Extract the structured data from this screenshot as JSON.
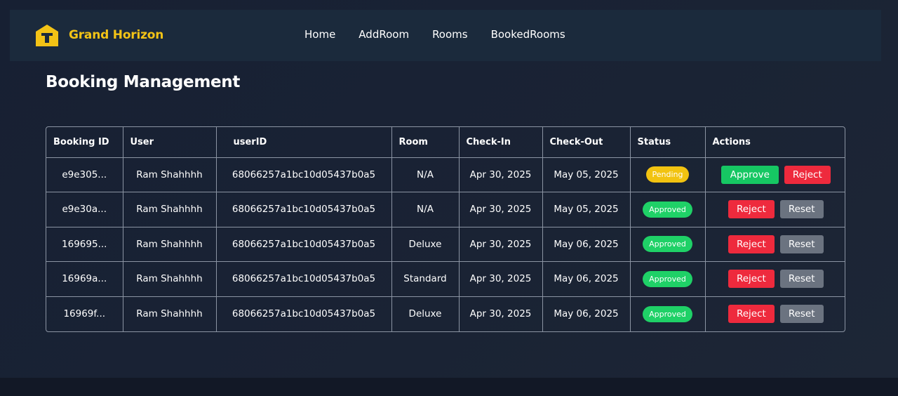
{
  "brand": {
    "name": "Grand Horizon",
    "icon": "hotel-logo-icon"
  },
  "nav": [
    "Home",
    "AddRoom",
    "Rooms",
    "BookedRooms"
  ],
  "page_title": "Booking Management",
  "columns": [
    "Booking ID",
    "User",
    "userID",
    "Room",
    "Check-In",
    "Check-Out",
    "Status",
    "Actions"
  ],
  "rows": [
    {
      "id": "e9e305...",
      "user": "Ram Shahhhh",
      "userID": "68066257a1bc10d05437b0a5",
      "room": "N/A",
      "check_in": "Apr 30, 2025",
      "check_out": "May 05, 2025",
      "status": "Pending",
      "actions": [
        "Approve",
        "Reject"
      ]
    },
    {
      "id": "e9e30a...",
      "user": "Ram Shahhhh",
      "userID": "68066257a1bc10d05437b0a5",
      "room": "N/A",
      "check_in": "Apr 30, 2025",
      "check_out": "May 05, 2025",
      "status": "Approved",
      "actions": [
        "Reject",
        "Reset"
      ]
    },
    {
      "id": "169695...",
      "user": "Ram Shahhhh",
      "userID": "68066257a1bc10d05437b0a5",
      "room": "Deluxe",
      "check_in": "Apr 30, 2025",
      "check_out": "May 06, 2025",
      "status": "Approved",
      "actions": [
        "Reject",
        "Reset"
      ]
    },
    {
      "id": "16969a...",
      "user": "Ram Shahhhh",
      "userID": "68066257a1bc10d05437b0a5",
      "room": "Standard",
      "check_in": "Apr 30, 2025",
      "check_out": "May 06, 2025",
      "status": "Approved",
      "actions": [
        "Reject",
        "Reset"
      ]
    },
    {
      "id": "16969f...",
      "user": "Ram Shahhhh",
      "userID": "68066257a1bc10d05437b0a5",
      "room": "Deluxe",
      "check_in": "Apr 30, 2025",
      "check_out": "May 06, 2025",
      "status": "Approved",
      "actions": [
        "Reject",
        "Reset"
      ]
    }
  ],
  "colors": {
    "accent": "#f3c316",
    "approve": "#16c763",
    "reject": "#ee2a3d",
    "reset": "#6b7380",
    "pending": "#f2c311",
    "approved": "#1fd167"
  }
}
